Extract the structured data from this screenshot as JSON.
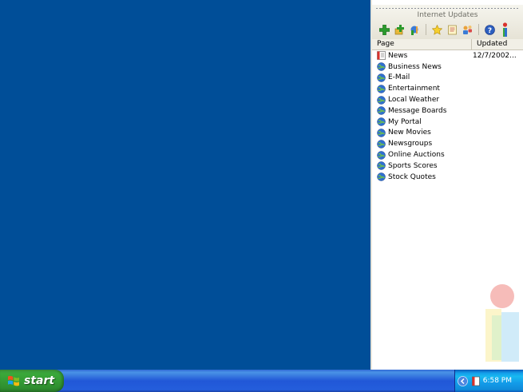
{
  "panel": {
    "title": "Internet Updates",
    "columns": {
      "page": "Page",
      "updated": "Updated"
    },
    "rows": [
      {
        "label": "News",
        "updated": "12/7/2002...",
        "icon": "news-page-icon"
      },
      {
        "label": "Business News",
        "updated": "",
        "icon": "globe-icon"
      },
      {
        "label": "E-Mail",
        "updated": "",
        "icon": "globe-icon"
      },
      {
        "label": "Entertainment",
        "updated": "",
        "icon": "globe-icon"
      },
      {
        "label": "Local Weather",
        "updated": "",
        "icon": "globe-icon"
      },
      {
        "label": "Message Boards",
        "updated": "",
        "icon": "globe-icon"
      },
      {
        "label": "My Portal",
        "updated": "",
        "icon": "globe-icon"
      },
      {
        "label": "New Movies",
        "updated": "",
        "icon": "globe-icon"
      },
      {
        "label": "Newsgroups",
        "updated": "",
        "icon": "globe-icon"
      },
      {
        "label": "Online Auctions",
        "updated": "",
        "icon": "globe-icon"
      },
      {
        "label": "Sports Scores",
        "updated": "",
        "icon": "globe-icon"
      },
      {
        "label": "Stock Quotes",
        "updated": "",
        "icon": "globe-icon"
      }
    ],
    "toolbar_icons": [
      "add-icon",
      "add-group-icon",
      "properties-icon",
      "favorite-icon",
      "notes-icon",
      "users-icon",
      "help-icon",
      "info-icon"
    ]
  },
  "taskbar": {
    "start_label": "start",
    "clock": "6:58 PM"
  },
  "colors": {
    "desktop": "#004e98",
    "taskbar": "#245edc",
    "start": "#3aa83a"
  }
}
